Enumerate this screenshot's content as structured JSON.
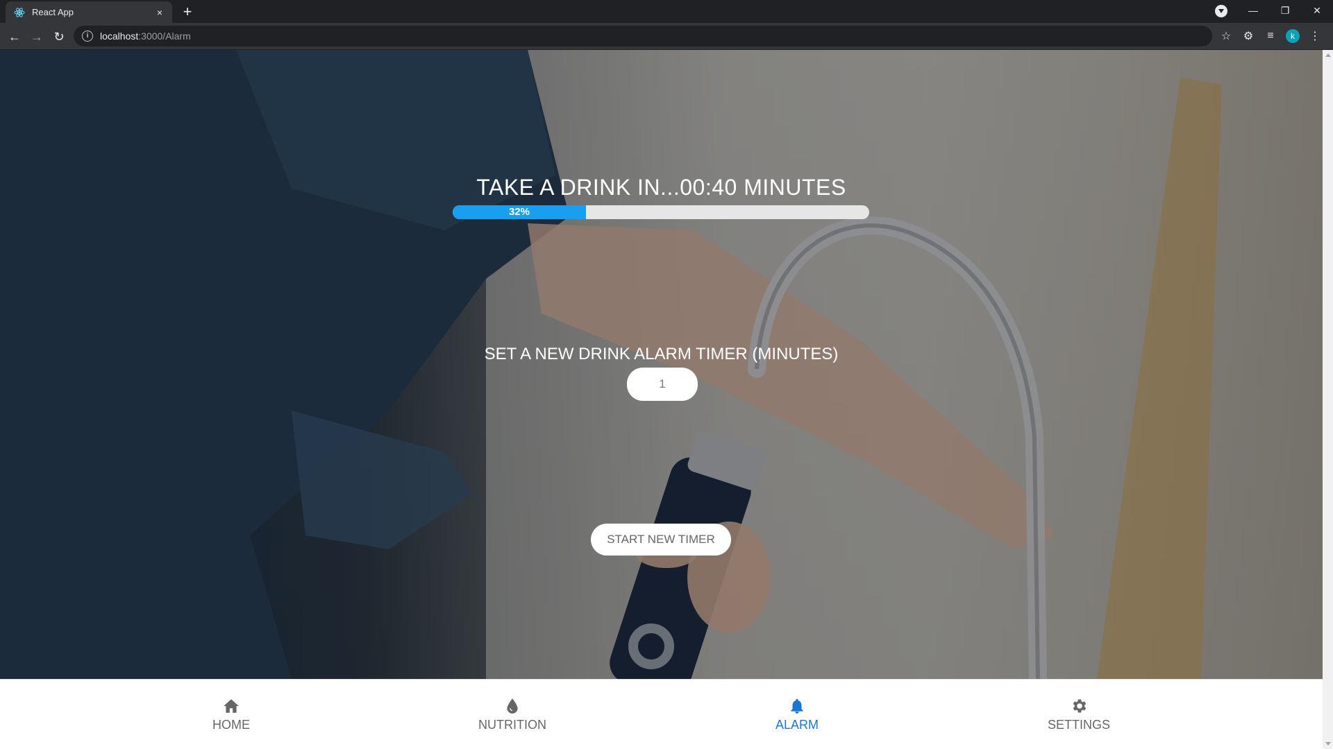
{
  "browser": {
    "tab_title": "React App",
    "tab_close": "×",
    "new_tab": "+",
    "url_host": "localhost",
    "url_path": ":3000/Alarm",
    "profile_initial": "k"
  },
  "timer": {
    "countdown_text": "TAKE A DRINK IN...00:40 MINUTES",
    "progress_label": "32%",
    "progress_percent": 32,
    "progress_color": "#1a9ff0"
  },
  "form": {
    "set_label": "SET A NEW DRINK ALARM TIMER (MINUTES)",
    "minutes_value": "1",
    "start_button": "START NEW TIMER"
  },
  "bottom_nav": {
    "active_color": "#1976d2",
    "items": [
      {
        "label": "HOME",
        "icon": "home-icon"
      },
      {
        "label": "NUTRITION",
        "icon": "water-drop-icon"
      },
      {
        "label": "ALARM",
        "icon": "bell-icon",
        "active": true
      },
      {
        "label": "SETTINGS",
        "icon": "gear-icon"
      }
    ]
  }
}
